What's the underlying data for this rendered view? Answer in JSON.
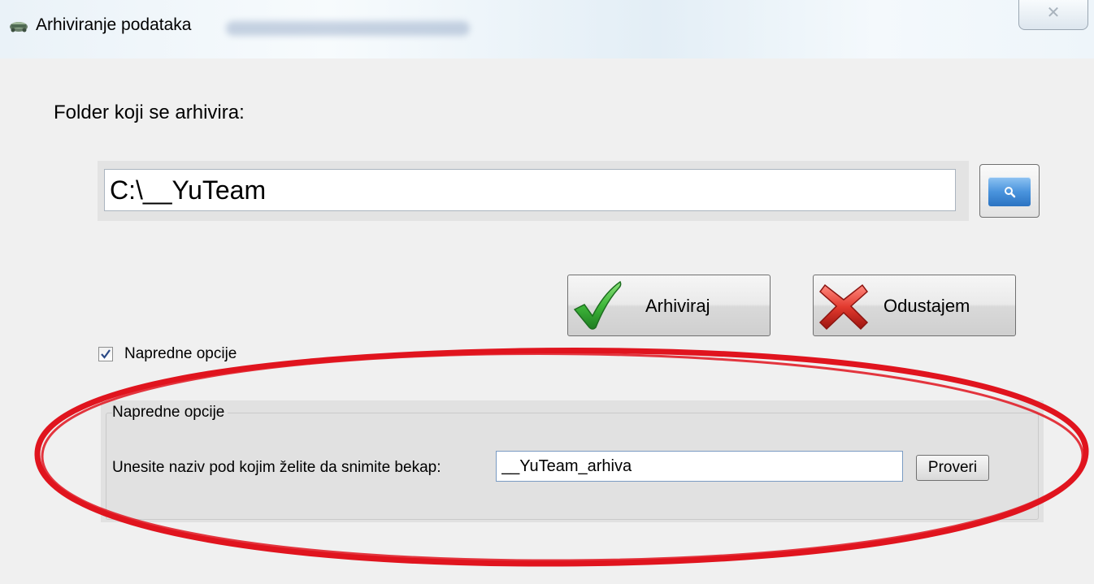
{
  "window": {
    "title": "Arhiviranje podataka",
    "close_glyph": "✕",
    "app_icon": "archive-app-icon"
  },
  "folder": {
    "label": "Folder koji se arhivira:",
    "path_value": "C:\\__YuTeam",
    "browse_icon": "search-icon"
  },
  "actions": {
    "archive_label": "Arhiviraj",
    "archive_icon": "green-checkmark-icon",
    "cancel_label": "Odustajem",
    "cancel_icon": "red-x-icon"
  },
  "advanced": {
    "checkbox_label": "Napredne opcije",
    "checkbox_checked": true,
    "group_title": "Napredne opcije",
    "name_label": "Unesite naziv pod kojim želite da snimite bekap:",
    "name_value": "__YuTeam_arhiva",
    "check_button_label": "Proveri"
  },
  "colors": {
    "annotation": "#e0141e",
    "background": "#f0f0f0",
    "group_background": "#e1e1e1",
    "browse_accent": "#4a94dd"
  }
}
